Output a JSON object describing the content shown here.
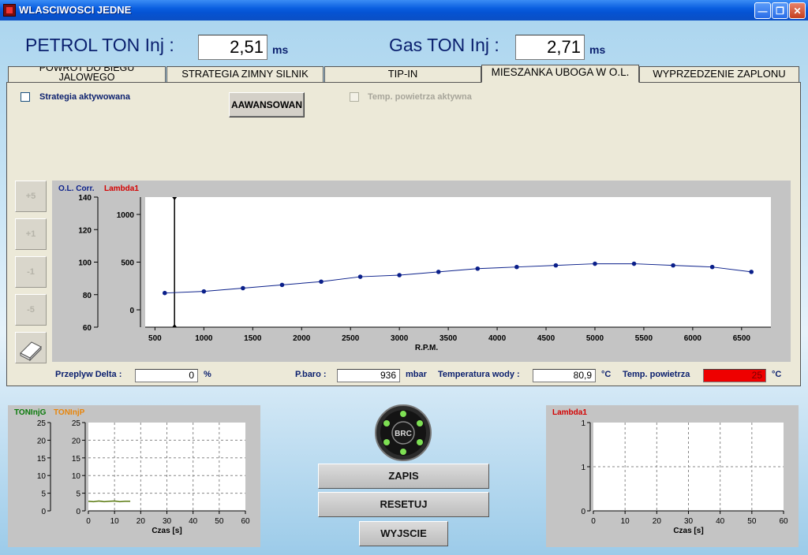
{
  "window": {
    "title": "WLASCIWOSCI JEDNE"
  },
  "header": {
    "petrol_label": "PETROL TON Inj :",
    "petrol_value": "2,51",
    "petrol_unit": "ms",
    "gas_label": "Gas TON Inj :",
    "gas_value": "2,71",
    "gas_unit": "ms"
  },
  "tabs": [
    {
      "label_line1": "POWROT DO BIEGU",
      "label_line2": "JALOWEGO"
    },
    {
      "label": "STRATEGIA ZIMNY SILNIK"
    },
    {
      "label": "TIP-IN"
    },
    {
      "label": "MIESZANKA UBOGA W O.L."
    },
    {
      "label": "WYPRZEDZENIE ZAPLONU"
    }
  ],
  "panel": {
    "strategy_label": "Strategia aktywowana",
    "advanced_button": "AAWANSOWAN",
    "temp_air_label": "Temp. powietrza aktywna",
    "side_buttons": [
      "+5",
      "+1",
      "-1",
      "-5"
    ]
  },
  "colors": {
    "series_blue": "#0a1f8a",
    "lambda_red": "#d40000",
    "temp_alert": "#ee0000"
  },
  "chart_data": [
    {
      "type": "line",
      "legend": [
        "O.L. Corr.",
        "Lambda1"
      ],
      "xlabel": "R.P.M.",
      "x_ticks": [
        500,
        1000,
        1500,
        2000,
        2500,
        3000,
        3500,
        4000,
        4500,
        5000,
        5500,
        6000,
        6500
      ],
      "left_axis_ticks": [
        60,
        80,
        100,
        120,
        140
      ],
      "right_axis_ticks": [
        0,
        500,
        1000
      ],
      "xlim": [
        400,
        6800
      ],
      "ylim": [
        60,
        140
      ],
      "cursor_x": 700,
      "series": [
        {
          "name": "O.L. Corr.",
          "x": [
            600,
            1000,
            1400,
            1800,
            2200,
            2600,
            3000,
            3400,
            3800,
            4200,
            4600,
            5000,
            5400,
            5800,
            6200,
            6600
          ],
          "y": [
            81,
            82,
            84,
            86,
            88,
            91,
            92,
            94,
            96,
            97,
            98,
            99,
            99,
            98,
            97,
            94
          ]
        }
      ]
    },
    {
      "type": "line",
      "legend": [
        "TONInjG",
        "TONInjP"
      ],
      "xlabel": "Czas [s]",
      "x_ticks": [
        0,
        10,
        20,
        30,
        40,
        50,
        60
      ],
      "y_ticks": [
        0,
        5,
        10,
        15,
        20,
        25
      ],
      "xlim": [
        0,
        60
      ],
      "ylim": [
        0,
        25
      ],
      "series": [
        {
          "name": "TONInjG",
          "x": [
            0,
            2,
            4,
            6,
            8,
            10,
            12,
            14,
            16
          ],
          "y": [
            2.7,
            2.6,
            2.8,
            2.6,
            2.7,
            2.8,
            2.6,
            2.7,
            2.7
          ]
        }
      ]
    },
    {
      "type": "line",
      "legend": [
        "Lambda1"
      ],
      "xlabel": "Czas [s]",
      "x_ticks": [
        0,
        10,
        20,
        30,
        40,
        50,
        60
      ],
      "y_ticks": [
        "0",
        "1",
        "1"
      ],
      "xlim": [
        0,
        60
      ],
      "series": []
    }
  ],
  "fields": {
    "przeplyw_label": "Przeplyw Delta :",
    "przeplyw_value": "0",
    "przeplyw_unit": "%",
    "pbaro_label": "P.baro :",
    "pbaro_value": "936",
    "pbaro_unit": "mbar",
    "temp_wody_label": "Temperatura wody :",
    "temp_wody_value": "80,9",
    "temp_wody_unit": "°C",
    "temp_pow_label": "Temp. powietrza",
    "temp_pow_value": "25",
    "temp_pow_unit": "°C"
  },
  "logo": {
    "text": "BRC"
  },
  "buttons": {
    "zapis": "ZAPIS",
    "resetuj": "RESETUJ",
    "wyjscie": "WYJSCIE"
  }
}
